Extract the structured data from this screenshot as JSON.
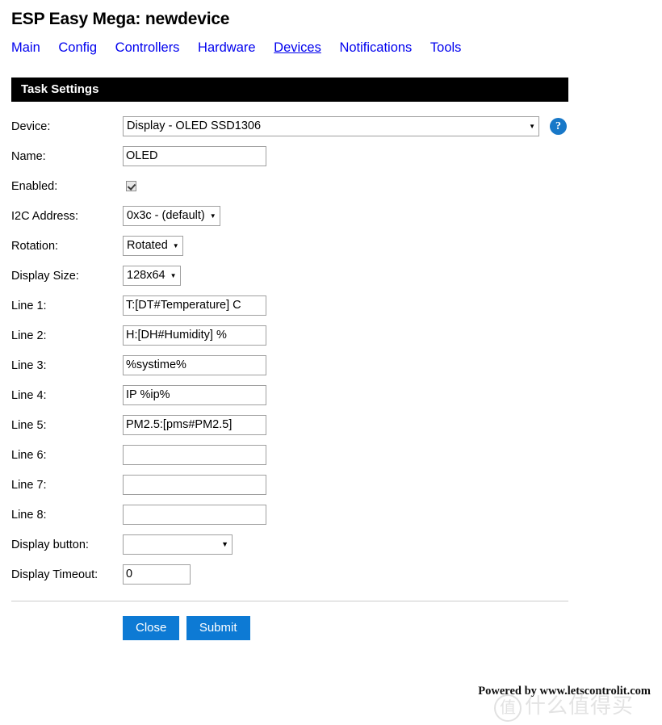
{
  "header": {
    "title": "ESP Easy Mega: newdevice"
  },
  "nav": {
    "items": [
      {
        "label": "Main",
        "active": false
      },
      {
        "label": "Config",
        "active": false
      },
      {
        "label": "Controllers",
        "active": false
      },
      {
        "label": "Hardware",
        "active": false
      },
      {
        "label": "Devices",
        "active": true
      },
      {
        "label": "Notifications",
        "active": false
      },
      {
        "label": "Tools",
        "active": false
      }
    ]
  },
  "section": {
    "title": "Task Settings"
  },
  "form": {
    "device": {
      "label": "Device:",
      "value": "Display - OLED SSD1306",
      "help_icon": "question-mark-icon",
      "help_glyph": "?"
    },
    "name": {
      "label": "Name:",
      "value": "OLED",
      "placeholder": ""
    },
    "enabled": {
      "label": "Enabled:",
      "checked": true
    },
    "i2c_address": {
      "label": "I2C Address:",
      "value": "0x3c - (default)"
    },
    "rotation": {
      "label": "Rotation:",
      "value": "Rotated"
    },
    "display_size": {
      "label": "Display Size:",
      "value": "128x64"
    },
    "lines": [
      {
        "label": "Line 1:",
        "value": "T:[DT#Temperature] C"
      },
      {
        "label": "Line 2:",
        "value": "H:[DH#Humidity] %"
      },
      {
        "label": "Line 3:",
        "value": "%systime%"
      },
      {
        "label": "Line 4:",
        "value": "IP %ip%"
      },
      {
        "label": "Line 5:",
        "value": "PM2.5:[pms#PM2.5]"
      },
      {
        "label": "Line 6:",
        "value": ""
      },
      {
        "label": "Line 7:",
        "value": ""
      },
      {
        "label": "Line 8:",
        "value": ""
      }
    ],
    "display_button": {
      "label": "Display button:",
      "value": ""
    },
    "display_timeout": {
      "label": "Display Timeout:",
      "value": "0"
    }
  },
  "actions": {
    "close_label": "Close",
    "submit_label": "Submit"
  },
  "footer": {
    "text": "Powered by www.letscontrolit.com"
  },
  "watermark": {
    "mark": "值",
    "text": "什么值得买"
  },
  "colors": {
    "link": "#0000ee",
    "accent": "#0d7ad4",
    "help_badge": "#1878c8",
    "header_bar": "#000000",
    "field_border": "#a0a0a0"
  },
  "icons": {
    "dropdown_arrow": "▼"
  }
}
